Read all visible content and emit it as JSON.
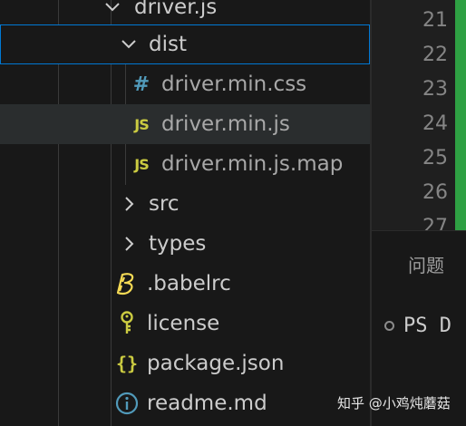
{
  "explorer": {
    "items": [
      {
        "label": "driver.js",
        "kind": "folder-open"
      },
      {
        "label": "dist",
        "kind": "folder-open"
      },
      {
        "label": "driver.min.css",
        "kind": "css-file",
        "icon": "#"
      },
      {
        "label": "driver.min.js",
        "kind": "js-file",
        "icon": "JS"
      },
      {
        "label": "driver.min.js.map",
        "kind": "js-map-file",
        "icon": "JS"
      },
      {
        "label": "src",
        "kind": "folder-closed"
      },
      {
        "label": "types",
        "kind": "folder-closed"
      },
      {
        "label": ".babelrc",
        "kind": "babel-file",
        "icon": "babel-icon"
      },
      {
        "label": "license",
        "kind": "license-file",
        "icon": "key-icon"
      },
      {
        "label": "package.json",
        "kind": "json-file",
        "icon": "{}"
      },
      {
        "label": "readme.md",
        "kind": "readme-file",
        "icon": "info-icon"
      }
    ]
  },
  "editor": {
    "line_numbers": [
      "21",
      "22",
      "23",
      "24",
      "25",
      "26",
      "27"
    ]
  },
  "panel": {
    "tab_label": "问题",
    "terminal_prompt": "PS D"
  },
  "watermark": "知乎 @小鸡炖蘑菇",
  "colors": {
    "sidebar_bg": "#181818",
    "focus_border": "#0078d4",
    "hover_bg": "#2a2d2e",
    "js_icon": "#cbcb41",
    "css_icon": "#519aba",
    "scroll_indicator": "#2ea043"
  }
}
